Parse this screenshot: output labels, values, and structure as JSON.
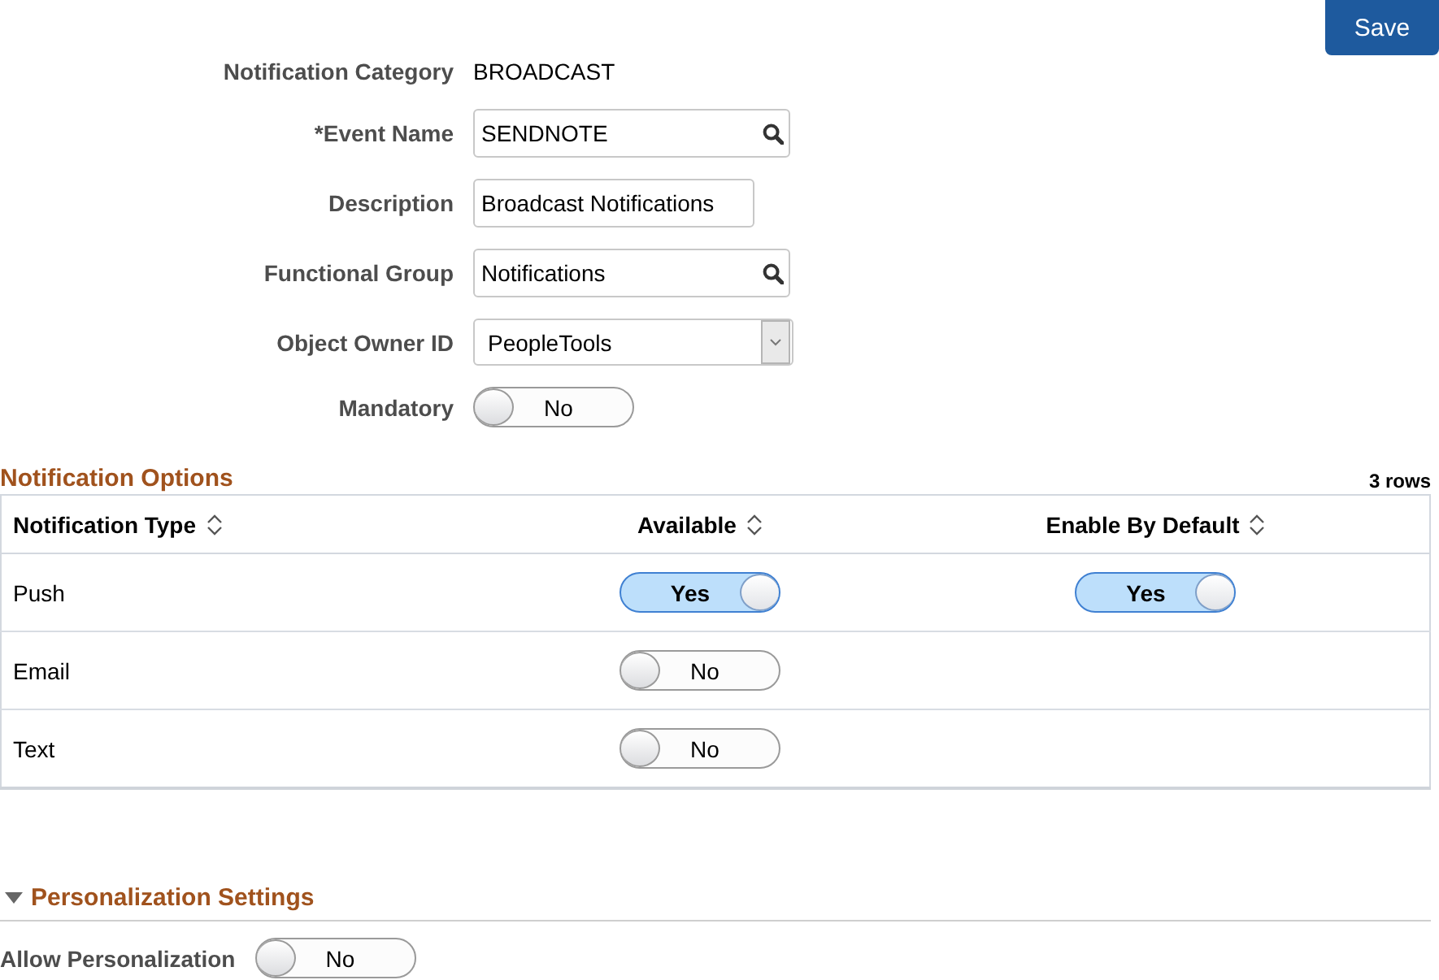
{
  "save_button": "Save",
  "form": {
    "fields": [
      {
        "kind": "text",
        "label": "Notification Category",
        "value": "BROADCAST"
      },
      {
        "kind": "lookup",
        "label": "*Event Name",
        "value": "SENDNOTE"
      },
      {
        "kind": "input",
        "label": "Description",
        "value": "Broadcast Notifications"
      },
      {
        "kind": "lookup",
        "label": "Functional Group",
        "value": "Notifications"
      },
      {
        "kind": "select",
        "label": "Object Owner ID",
        "value": "PeopleTools"
      },
      {
        "kind": "toggle",
        "label": "Mandatory",
        "on": false,
        "text": "No"
      }
    ]
  },
  "notification_options": {
    "title": "Notification Options",
    "row_count": "3 rows",
    "columns": [
      "Notification Type",
      "Available",
      "Enable By Default"
    ],
    "rows": [
      {
        "type": "Push",
        "available": {
          "on": true,
          "text": "Yes"
        },
        "enable_by_default": {
          "on": true,
          "text": "Yes"
        }
      },
      {
        "type": "Email",
        "available": {
          "on": false,
          "text": "No"
        }
      },
      {
        "type": "Text",
        "available": {
          "on": false,
          "text": "No"
        }
      }
    ]
  },
  "personalization": {
    "title": "Personalization Settings",
    "expanded": true,
    "allow": {
      "label": "Allow Personalization",
      "on": false,
      "text": "No"
    }
  }
}
